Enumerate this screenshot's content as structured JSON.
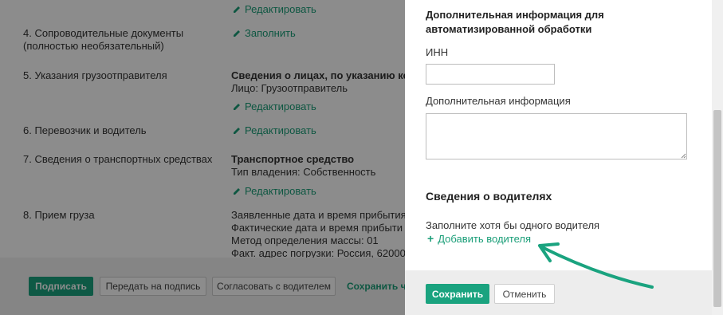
{
  "list": {
    "top_edit": "Редактировать",
    "rows": [
      {
        "label": "4. Сопроводительные документы (полностью необязательный)",
        "action": "Заполнить"
      },
      {
        "label": "5. Указания грузоотправителя",
        "title": "Сведения о лицах, по указанию кот",
        "detail": "Лицо: Грузоотправитель",
        "action": "Редактировать"
      },
      {
        "label": "6. Перевозчик и водитель",
        "action": "Редактировать"
      },
      {
        "label": "7. Сведения о транспортных средствах",
        "title": "Транспортное средство",
        "detail": "Тип владения: Собственность",
        "action": "Редактировать"
      },
      {
        "label": "8. Прием груза",
        "lines": [
          "Заявленные дата и время прибытия:",
          "Фактические дата и время прибыти",
          "Метод определения массы: 01",
          "Факт. адрес погрузки: Россия, 62000"
        ]
      }
    ]
  },
  "footer": {
    "sign": "Подписать",
    "send_to_sign": "Передать на подпись",
    "agree_driver": "Согласовать с водителем",
    "save_draft": "Сохранить чер"
  },
  "panel": {
    "auto_title": "Дополнительная информация для автоматизированной обработки",
    "inn_label": "ИНН",
    "inn_value": "",
    "extra_label": "Дополнительная информация",
    "extra_value": "",
    "drivers_title": "Сведения о водителях",
    "drivers_hint": "Заполните хотя бы одного водителя",
    "add_driver": "Добавить водителя",
    "save": "Сохранить",
    "cancel": "Отменить"
  },
  "colors": {
    "accent": "#1aa37f",
    "overlay": "rgba(0,0,0,0.45)"
  }
}
